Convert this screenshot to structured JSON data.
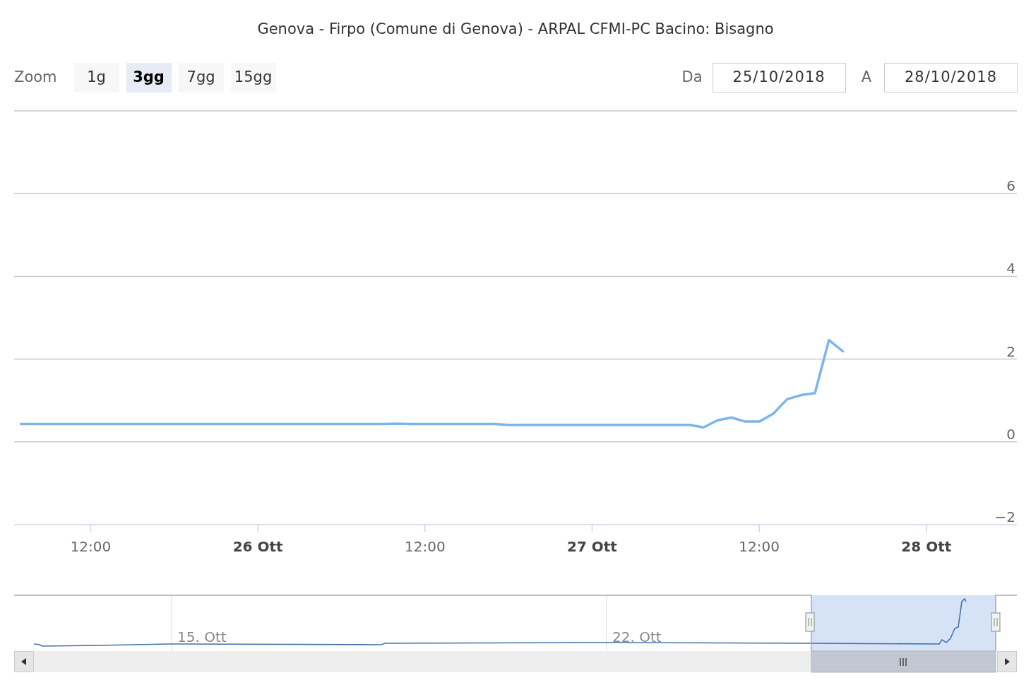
{
  "title": "Genova - Firpo (Comune di Genova) - ARPAL CFMI-PC Bacino: Bisagno",
  "range_selector": {
    "label": "Zoom",
    "buttons": [
      {
        "label": "1g",
        "selected": false
      },
      {
        "label": "3gg",
        "selected": true
      },
      {
        "label": "7gg",
        "selected": false
      },
      {
        "label": "15gg",
        "selected": false
      }
    ]
  },
  "date_range": {
    "from_label": "Da",
    "from": "25/10/2018",
    "to_label": "A",
    "to": "28/10/2018"
  },
  "chart": {
    "chart_data": {
      "type": "line",
      "categories": [
        null,
        null,
        null,
        null,
        null,
        "12:00",
        null,
        null,
        null,
        null,
        null,
        null,
        null,
        null,
        null,
        null,
        null,
        "26 Ott",
        null,
        null,
        null,
        null,
        null,
        null,
        null,
        null,
        null,
        null,
        null,
        "12:00",
        null,
        null,
        null,
        null,
        null,
        null,
        null,
        null,
        null,
        null,
        null,
        "27 Ott",
        null,
        null,
        null,
        null,
        null,
        null,
        null,
        null,
        null,
        null,
        null,
        "12:00",
        null,
        null,
        null,
        null,
        null,
        null,
        null,
        null,
        null,
        null,
        null,
        "28 Ott",
        null,
        null,
        null,
        null,
        null,
        null
      ],
      "series": [
        {
          "color": "#7cb5ec",
          "values": [
            0.43,
            0.43,
            0.43,
            0.43,
            0.43,
            0.43,
            0.43,
            0.43,
            0.43,
            0.43,
            0.43,
            0.43,
            0.43,
            0.43,
            0.43,
            0.43,
            0.43,
            0.43,
            0.43,
            0.43,
            0.43,
            0.43,
            0.43,
            0.43,
            0.43,
            0.43,
            0.43,
            0.44,
            0.43,
            0.43,
            0.43,
            0.43,
            0.43,
            0.43,
            0.43,
            0.41,
            0.41,
            0.41,
            0.41,
            0.41,
            0.41,
            0.41,
            0.41,
            0.41,
            0.41,
            0.41,
            0.41,
            0.41,
            0.41,
            0.35,
            0.52,
            0.59,
            0.49,
            0.49,
            0.68,
            1.03,
            1.13,
            1.18,
            2.46,
            2.19,
            null,
            null,
            null,
            null,
            null,
            null,
            null,
            null,
            null,
            null,
            null,
            null
          ]
        }
      ],
      "ylim": [
        -2,
        8
      ],
      "grid": true,
      "yticks": [
        -2,
        0,
        2,
        4,
        6
      ]
    }
  },
  "navigator": {
    "labels": [
      "15. Ott",
      "22. Ott"
    ]
  }
}
